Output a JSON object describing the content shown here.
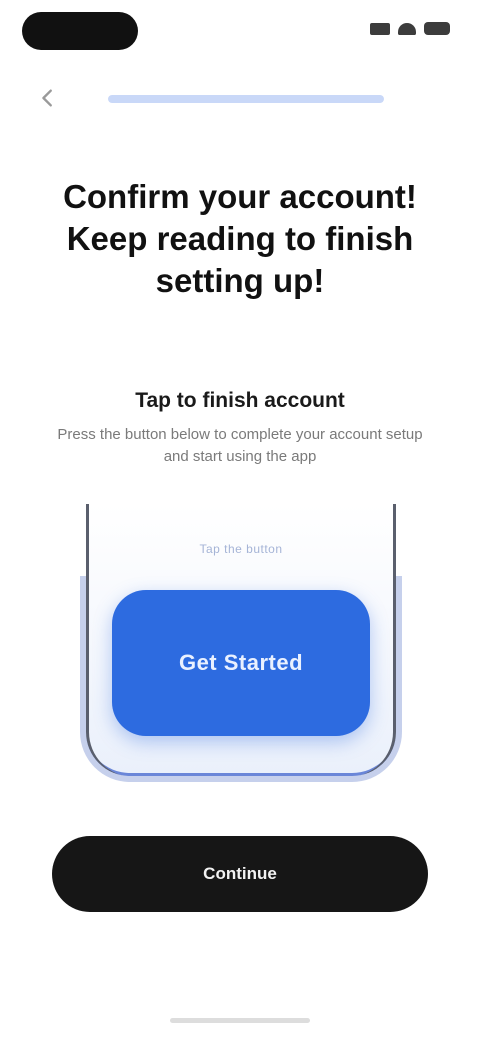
{
  "status_bar": {
    "icons": [
      "signal-icon",
      "wifi-icon",
      "battery-icon"
    ]
  },
  "nav": {
    "back_icon": "chevron-left-icon",
    "progress_fraction": 1.0
  },
  "headline": "Confirm your account! Keep reading to finish setting up!",
  "section": {
    "title": "Tap to finish account",
    "description": "Press the button below to complete your account setup and start using the app"
  },
  "illustration": {
    "caption": "Tap the button",
    "button_label": "Get Started"
  },
  "continue_button": {
    "label": "Continue"
  },
  "colors": {
    "accent": "#2d6be0",
    "primary_button": "#161616",
    "progress_track": "#e8eefc",
    "progress_fill": "#c9d8f8"
  }
}
